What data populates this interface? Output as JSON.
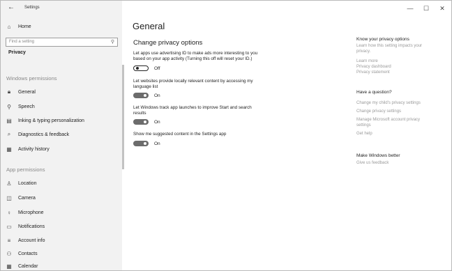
{
  "titlebar": {
    "back": "←",
    "title": "Settings",
    "minimize": "—",
    "maximize": "☐",
    "close": "✕"
  },
  "sidebar": {
    "home": "Home",
    "search_placeholder": "Find a setting",
    "category": "Privacy",
    "windows_permissions_header": "Windows permissions",
    "windows_permissions": [
      "General",
      "Speech",
      "Inking & typing personalization",
      "Diagnostics & feedback",
      "Activity history"
    ],
    "app_permissions_header": "App permissions",
    "app_permissions": [
      "Location",
      "Camera",
      "Microphone",
      "Notifications",
      "Account info",
      "Contacts",
      "Calendar"
    ]
  },
  "main": {
    "title": "General",
    "subtitle": "Change privacy options",
    "options": [
      {
        "line1": "Let apps use advertising ID to make ads more interesting to you",
        "line2": "based on your app activity (Turning this off will reset your ID.)",
        "state": "Off",
        "on": false
      },
      {
        "line1": "Let websites provide locally relevant content by accessing my",
        "line2": "language list",
        "state": "On",
        "on": true
      },
      {
        "line1": "Let Windows track app launches to improve Start and search",
        "line2": "results",
        "state": "On",
        "on": true
      },
      {
        "line1": "Show me suggested content in the Settings app",
        "line2": "",
        "state": "On",
        "on": true
      }
    ]
  },
  "right": {
    "know_header": "Know your privacy options",
    "know_desc1": "Learn how this setting impacts your",
    "know_desc2": "privacy.",
    "know_links": [
      "Learn more",
      "Privacy dashboard",
      "Privacy statement"
    ],
    "question_header": "Have a question?",
    "question_links": [
      "Change my child's privacy settings",
      "Change privacy settings",
      "Manage Microsoft account privacy",
      "settings",
      "Get help"
    ],
    "better_header": "Make Windows better",
    "better_link": "Give us feedback"
  },
  "colors": {
    "sidebar_bg": "#f2f2f2",
    "toggle_on": "#6c6c6c",
    "link": "#9a9a9a"
  }
}
